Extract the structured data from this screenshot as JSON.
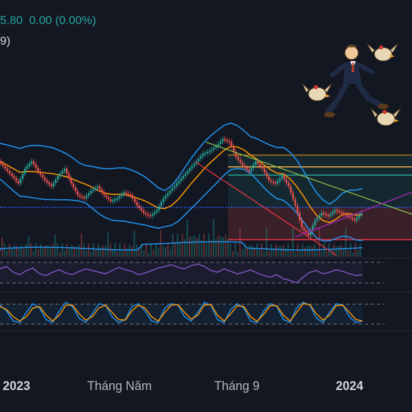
{
  "header": {
    "change_value": "5.80",
    "change_abs": "0.00",
    "change_pct": "(0.00%)",
    "indicator_fragment": "9)"
  },
  "x_axis_labels": [
    {
      "text": "2023",
      "bold": true
    },
    {
      "text": "Tháng Năm",
      "bold": false
    },
    {
      "text": "Tháng 9",
      "bold": false
    },
    {
      "text": "2024",
      "bold": true
    }
  ],
  "colors": {
    "background": "#131722",
    "candle_up": "#26a69a",
    "candle_down": "#ef5350",
    "bollinger": "#2196f3",
    "moving_average": "#ff9800",
    "rsi_line": "#7e57c2",
    "stoch_k": "#2196f3",
    "stoch_d": "#ff9800",
    "trend_red": "#f23645",
    "trend_green": "#8bc34a",
    "trend_purple": "#9c27b0"
  },
  "icons": {
    "mascot": "running-man-with-chickens-icon"
  },
  "chart_data": {
    "type": "candlestick",
    "title": "",
    "price_series": [
      5.95,
      5.9,
      5.85,
      5.8,
      5.9,
      5.95,
      5.88,
      5.82,
      5.78,
      5.85,
      5.9,
      5.8,
      5.72,
      5.7,
      5.75,
      5.78,
      5.72,
      5.68,
      5.7,
      5.74,
      5.72,
      5.65,
      5.6,
      5.58,
      5.62,
      5.7,
      5.75,
      5.8,
      5.85,
      5.9,
      5.95,
      6.0,
      6.02,
      6.05,
      6.1,
      6.08,
      5.98,
      5.92,
      5.88,
      5.95,
      5.9,
      5.82,
      5.8,
      5.85,
      5.78,
      5.65,
      5.5,
      5.45,
      5.55,
      5.6,
      5.58,
      5.62,
      5.6,
      5.58,
      5.55,
      5.6
    ],
    "bands": [
      "bollinger-upper",
      "bollinger-lower",
      "moving-average"
    ],
    "panels": [
      "price",
      "volume",
      "rsi",
      "stochastic"
    ],
    "rsi_series": [
      52,
      55,
      48,
      45,
      50,
      53,
      46,
      44,
      48,
      51,
      47,
      45,
      49,
      52,
      50,
      48,
      46,
      50,
      54,
      51,
      49,
      45,
      47,
      50,
      53,
      55,
      57,
      54,
      52,
      56,
      58,
      55,
      50,
      48,
      52,
      49,
      46,
      48,
      51,
      47,
      44,
      42,
      45,
      40,
      38,
      35,
      42,
      48,
      50,
      46,
      48,
      51,
      49,
      46,
      44,
      45
    ],
    "stoch_k": [
      80,
      60,
      25,
      20,
      55,
      85,
      70,
      30,
      20,
      60,
      90,
      75,
      35,
      20,
      50,
      85,
      80,
      40,
      20,
      30,
      75,
      85,
      60,
      25,
      20,
      70,
      85,
      80,
      40,
      25,
      55,
      90,
      80,
      30,
      20,
      65,
      85,
      70,
      25,
      20,
      60,
      85,
      75,
      30,
      20,
      70,
      90,
      80,
      35,
      20,
      55,
      85,
      80,
      40,
      20,
      25
    ],
    "stoch_d": [
      75,
      65,
      40,
      25,
      40,
      70,
      75,
      45,
      25,
      45,
      80,
      80,
      50,
      28,
      40,
      70,
      80,
      55,
      30,
      28,
      60,
      80,
      70,
      40,
      25,
      55,
      80,
      82,
      55,
      32,
      45,
      80,
      82,
      45,
      25,
      50,
      78,
      75,
      40,
      24,
      48,
      78,
      78,
      45,
      25,
      55,
      85,
      82,
      50,
      28,
      45,
      78,
      80,
      55,
      30,
      25
    ]
  }
}
